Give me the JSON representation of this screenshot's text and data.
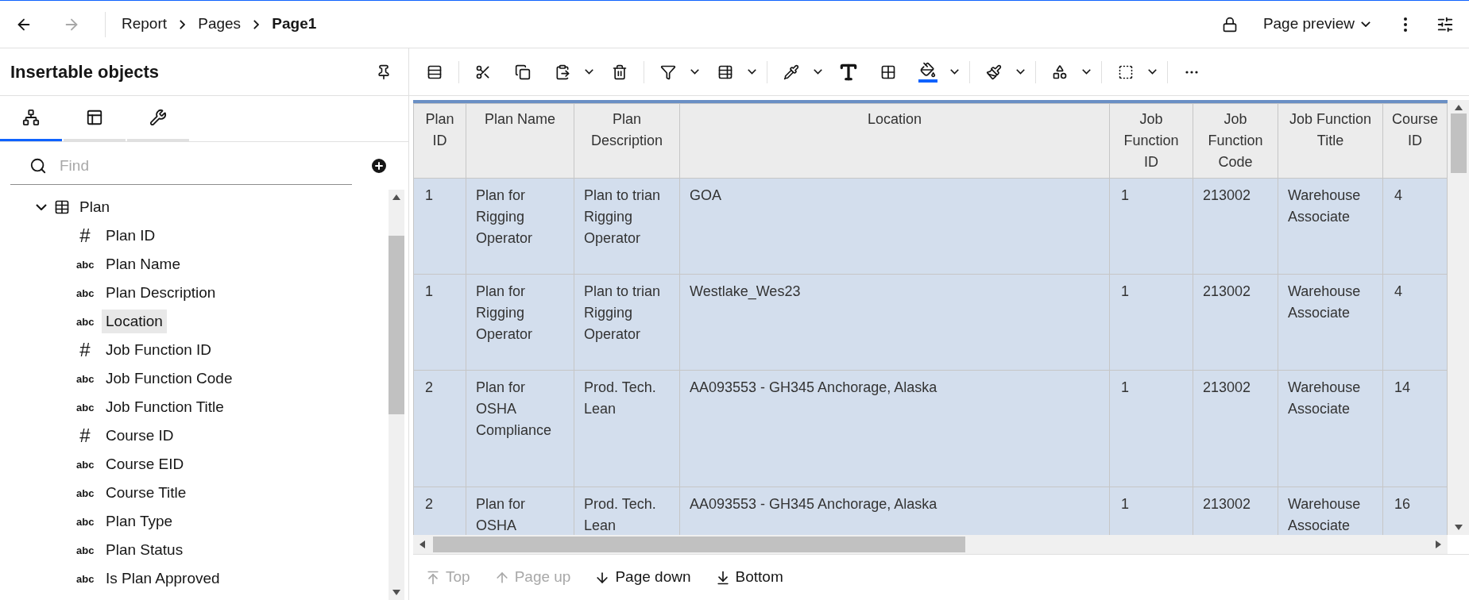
{
  "breadcrumb": [
    {
      "label": "Report",
      "current": false
    },
    {
      "label": "Pages",
      "current": false
    },
    {
      "label": "Page1",
      "current": true
    }
  ],
  "view_menu": {
    "label": "Page preview"
  },
  "panel": {
    "title": "Insertable objects",
    "tabs": [
      {
        "kind": "source",
        "selected": true
      },
      {
        "kind": "toolbox",
        "selected": false
      },
      {
        "kind": "tools",
        "selected": false
      }
    ],
    "search": {
      "placeholder": "Find"
    },
    "tree": [
      {
        "label": "Plan",
        "expanded": true,
        "children": [
          {
            "label": "Plan ID",
            "type_mark": "#",
            "selected": false
          },
          {
            "label": "Plan Name",
            "type_mark": "abc",
            "selected": false
          },
          {
            "label": "Plan Description",
            "type_mark": "abc",
            "selected": false
          },
          {
            "label": "Location",
            "type_mark": "abc",
            "selected": true
          },
          {
            "label": "Job Function ID",
            "type_mark": "#",
            "selected": false
          },
          {
            "label": "Job Function Code",
            "type_mark": "abc",
            "selected": false
          },
          {
            "label": "Job Function Title",
            "type_mark": "abc",
            "selected": false
          },
          {
            "label": "Course ID",
            "type_mark": "#",
            "selected": false
          },
          {
            "label": "Course EID",
            "type_mark": "abc",
            "selected": false
          },
          {
            "label": "Course Title",
            "type_mark": "abc",
            "selected": false
          },
          {
            "label": "Plan Type",
            "type_mark": "abc",
            "selected": false
          },
          {
            "label": "Plan Status",
            "type_mark": "abc",
            "selected": false
          },
          {
            "label": "Is Plan Approved",
            "type_mark": "abc",
            "selected": false
          }
        ]
      }
    ]
  },
  "table": {
    "columns": [
      "Plan ID",
      "Plan Name",
      "Plan Description",
      "Location",
      "Job Function ID",
      "Job Function Code",
      "Job Function Title",
      "Course ID"
    ],
    "rows": [
      [
        "1",
        "Plan for Rigging Operator",
        "Plan to trian Rigging Operator",
        "GOA",
        "1",
        "213002",
        "Warehouse Associate",
        "4"
      ],
      [
        "1",
        "Plan for Rigging Operator",
        "Plan to trian Rigging Operator",
        "Westlake_Wes23",
        "1",
        "213002",
        "Warehouse Associate",
        "4"
      ],
      [
        "2",
        "Plan for OSHA Compliance",
        "Prod. Tech. Lean",
        "AA093553 - GH345 Anchorage, Alaska",
        "1",
        "213002",
        "Warehouse Associate",
        "14"
      ],
      [
        "2",
        "Plan for OSHA",
        "Prod. Tech. Lean",
        "AA093553 - GH345 Anchorage, Alaska",
        "1",
        "213002",
        "Warehouse Associate",
        "16"
      ]
    ]
  },
  "paging": [
    {
      "label": "Top",
      "kind": "top",
      "disabled": true
    },
    {
      "label": "Page up",
      "kind": "up",
      "disabled": true
    },
    {
      "label": "Page down",
      "kind": "down",
      "disabled": false
    },
    {
      "label": "Bottom",
      "kind": "bottom",
      "disabled": false
    }
  ]
}
